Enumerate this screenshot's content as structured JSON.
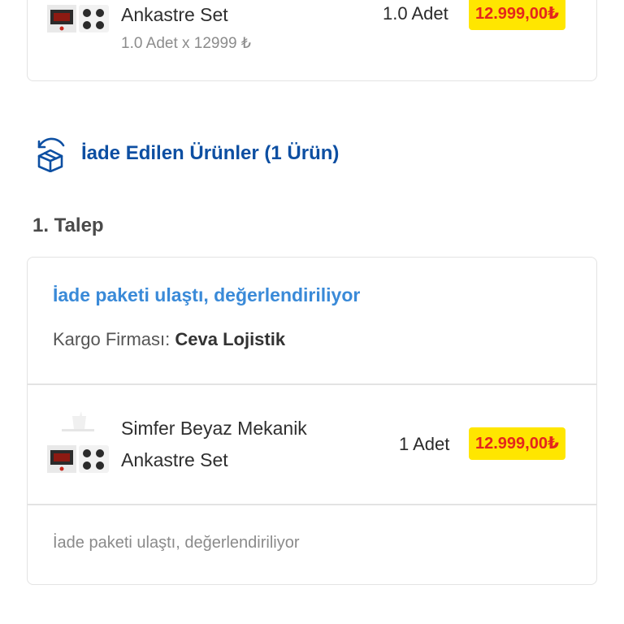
{
  "top_item": {
    "name_line2": "Ankastre Set",
    "sub": "1.0 Adet x 12999 ₺",
    "qty": "1.0 Adet",
    "price": "12.999,00₺"
  },
  "returns": {
    "title": "İade Edilen Ürünler (1 Ürün)",
    "icon": "return-box-icon",
    "request_label": "1. Talep",
    "status_title": "İade paketi ulaştı, değerlendiriliyor",
    "cargo_label": "Kargo Firması: ",
    "cargo_value": "Ceva Lojistik",
    "item": {
      "name_line1": "Simfer Beyaz Mekanik",
      "name_line2": "Ankastre Set",
      "qty": "1 Adet",
      "price": "12.999,00₺"
    },
    "footer_status": "İade paketi ulaştı, değerlendiriliyor"
  },
  "colors": {
    "brand_blue": "#0d4fa2",
    "status_blue": "#3a8ad8",
    "price_bg": "#ffe600",
    "price_text": "#e4261d"
  }
}
